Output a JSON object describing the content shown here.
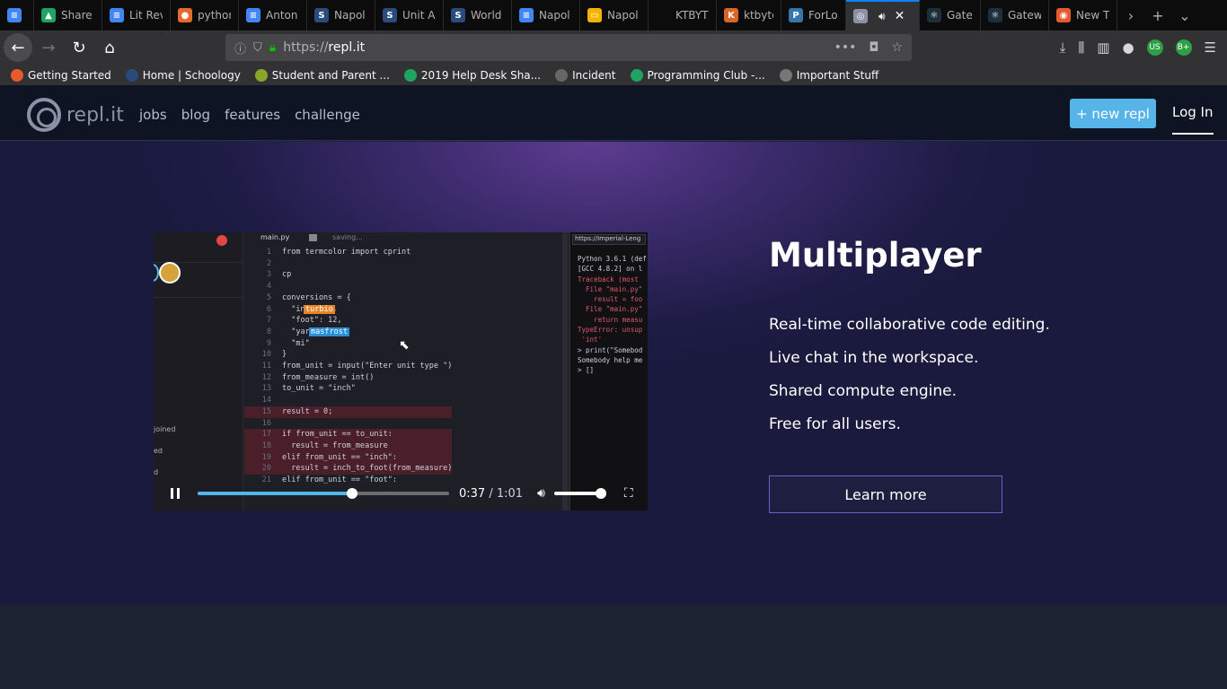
{
  "browser": {
    "tabs": [
      {
        "title": "",
        "icon": "docs"
      },
      {
        "title": "Share",
        "icon": "drive"
      },
      {
        "title": "Lit Rev",
        "icon": "docs"
      },
      {
        "title": "python",
        "icon": "orange"
      },
      {
        "title": "Anton",
        "icon": "docs"
      },
      {
        "title": "Napol",
        "icon": "schoology"
      },
      {
        "title": "Unit A",
        "icon": "schoology"
      },
      {
        "title": "World",
        "icon": "schoology"
      },
      {
        "title": "Napol",
        "icon": "docs"
      },
      {
        "title": "Napol",
        "icon": "slides"
      },
      {
        "title": "KTBYTE C",
        "icon": "none"
      },
      {
        "title": "ktbyte",
        "icon": "ktbyte"
      },
      {
        "title": "ForLoo",
        "icon": "python"
      },
      {
        "title": "",
        "icon": "replit"
      },
      {
        "title": "Gatew",
        "icon": "react"
      },
      {
        "title": "Gatew",
        "icon": "react"
      },
      {
        "title": "New T",
        "icon": "firefox"
      }
    ],
    "url": {
      "protocol": "https://",
      "domain": "repl.it"
    },
    "bookmarks": [
      {
        "label": "Getting Started"
      },
      {
        "label": "Home | Schoology"
      },
      {
        "label": "Student and Parent ..."
      },
      {
        "label": "2019 Help Desk Sha..."
      },
      {
        "label": "Incident"
      },
      {
        "label": "Programming Club -..."
      },
      {
        "label": "Important Stuff"
      }
    ],
    "badge_us": "US",
    "badge_b": "B+"
  },
  "site": {
    "logo": "repl.it",
    "nav": [
      "jobs",
      "blog",
      "features",
      "challenge"
    ],
    "new_repl": "+ new repl",
    "login": "Log In"
  },
  "hero": {
    "title": "Multiplayer",
    "features": [
      "Real-time collaborative code editing.",
      "Live chat in the workspace.",
      "Shared compute engine.",
      "Free for all users."
    ],
    "cta": "Learn more"
  },
  "video": {
    "filename": "main.py",
    "status": "saving...",
    "console_url": "https://Imperial-Leng",
    "progress_fraction": 0.613,
    "time_current": "0:37",
    "time_total": "/ 1:01",
    "volume_fraction": 1.0,
    "users": [
      "joined",
      "ed",
      "d"
    ],
    "cursors": [
      {
        "name": "turbio",
        "color": "#e6842a"
      },
      {
        "name": "masfrost",
        "color": "#2a8fd6"
      }
    ],
    "code": [
      "from termcolor import cprint",
      "",
      "cp",
      "",
      "conversions = {",
      "  \"inch\": 1,",
      "  \"foot\": 12,",
      "  \"yard\": 36,",
      "  \"mi\"",
      "}",
      "from_unit = input(\"Enter unit type \")",
      "from_measure = int()",
      "to_unit = \"inch\"",
      "",
      "result = 0;",
      "",
      "if from_unit == to_unit:",
      "  result = from_measure",
      "elif from_unit == \"inch\":",
      "  result = inch_to_foot(from_measure)",
      "elif from_unit == \"foot\":"
    ],
    "console": [
      "Python 3.6.1 (def",
      "[GCC 4.8.2] on l",
      "Traceback (most",
      "  File \"main.py\"",
      "    result = foo",
      "  File \"main.py\"",
      "    return measu",
      "TypeError: unsup",
      " 'int'",
      "> print(\"Somebod",
      "Somebody help me",
      "> []"
    ]
  }
}
